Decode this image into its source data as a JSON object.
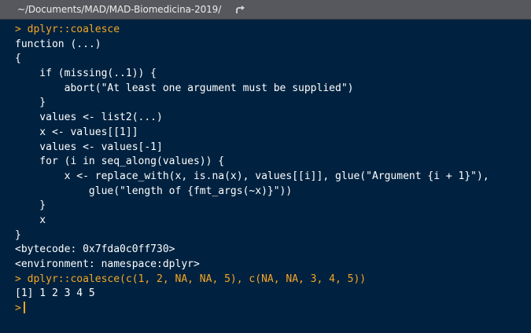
{
  "titlebar": {
    "path": "~/Documents/MAD/MAD-Biomedicina-2019/",
    "goto_icon": "arrow-turn-right-icon"
  },
  "colors": {
    "background": "#002240",
    "prompt": "#f5a623",
    "output": "#ffffff",
    "titlebar": "#56585d"
  },
  "console": {
    "prompt_symbol": ">",
    "lines": [
      {
        "type": "input",
        "text": "dplyr::coalesce"
      },
      {
        "type": "output",
        "text": "function (...)"
      },
      {
        "type": "output",
        "text": "{"
      },
      {
        "type": "output",
        "text": "    if (missing(..1)) {"
      },
      {
        "type": "output",
        "text": "        abort(\"At least one argument must be supplied\")"
      },
      {
        "type": "output",
        "text": "    }"
      },
      {
        "type": "output",
        "text": "    values <- list2(...)"
      },
      {
        "type": "output",
        "text": "    x <- values[[1]]"
      },
      {
        "type": "output",
        "text": "    values <- values[-1]"
      },
      {
        "type": "output",
        "text": "    for (i in seq_along(values)) {"
      },
      {
        "type": "output",
        "text": "        x <- replace_with(x, is.na(x), values[[i]], glue(\"Argument {i + 1}\"),"
      },
      {
        "type": "output",
        "text": "            glue(\"length of {fmt_args(~x)}\"))"
      },
      {
        "type": "output",
        "text": "    }"
      },
      {
        "type": "output",
        "text": "    x"
      },
      {
        "type": "output",
        "text": "}"
      },
      {
        "type": "output",
        "text": "<bytecode: 0x7fda0c0ff730>"
      },
      {
        "type": "output",
        "text": "<environment: namespace:dplyr>"
      },
      {
        "type": "input",
        "text": "dplyr::coalesce(c(1, 2, NA, NA, 5), c(NA, NA, 3, 4, 5))"
      },
      {
        "type": "output",
        "text": "[1] 1 2 3 4 5"
      }
    ],
    "current_input": ""
  }
}
